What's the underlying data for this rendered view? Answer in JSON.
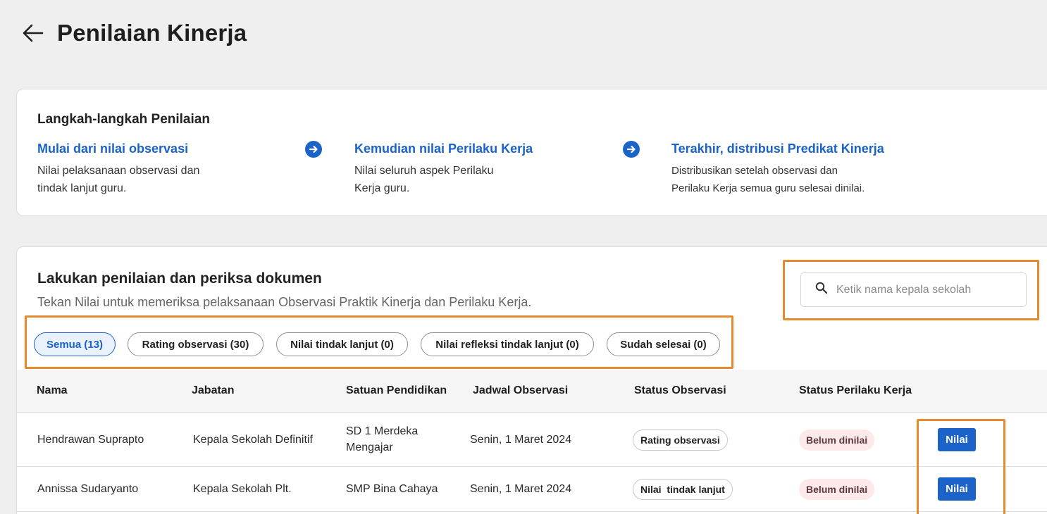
{
  "header": {
    "title": "Penilaian Kinerja",
    "back_icon": "arrow-left-icon"
  },
  "steps": {
    "title": "Langkah-langkah Penilaian",
    "items": [
      {
        "link": "Mulai dari nilai observasi",
        "desc_line1": "Nilai pelaksanaan observasi dan",
        "desc_line2": "tindak lanjut guru."
      },
      {
        "link": "Kemudian nilai Perilaku Kerja",
        "desc_line1": "Nilai seluruh aspek Perilaku",
        "desc_line2": "Kerja guru."
      },
      {
        "link": "Terakhir, distribusi Predikat Kinerja",
        "desc_line1": "Distribusikan setelah observasi dan",
        "desc_line2": "Perilaku Kerja semua guru selesai dinilai."
      }
    ],
    "arrow_icon": "arrow-right-circle-icon"
  },
  "list": {
    "title": "Lakukan penilaian dan periksa dokumen",
    "subtitle": "Tekan Nilai untuk memeriksa pelaksanaan Observasi Praktik Kinerja dan Perilaku Kerja.",
    "search": {
      "placeholder": "Ketik nama kepala sekolah",
      "value": ""
    },
    "filters": [
      {
        "label": "Semua (13)",
        "active": true
      },
      {
        "label": "Rating observasi (30)",
        "active": false
      },
      {
        "label": "Nilai tindak lanjut (0)",
        "active": false
      },
      {
        "label": "Nilai refleksi tindak lanjut (0)",
        "active": false
      },
      {
        "label": "Sudah selesai (0)",
        "active": false
      }
    ],
    "columns": [
      "Nama",
      "Jabatan",
      "Satuan Pendidikan",
      "Jadwal Observasi",
      "Status Observasi",
      "Status Perilaku Kerja"
    ],
    "rows": [
      {
        "nama": "Hendrawan Suprapto",
        "jabatan": "Kepala Sekolah Definitif",
        "satuan_line1": "SD 1 Merdeka",
        "satuan_line2": "Mengajar",
        "jadwal": "Senin, 1 Maret 2024",
        "status_observasi": "Rating observasi",
        "status_perilaku": "Belum dinilai",
        "action": "Nilai"
      },
      {
        "nama": "Annissa Sudaryanto",
        "jabatan": "Kepala Sekolah Plt.",
        "satuan_line1": "SMP Bina Cahaya",
        "satuan_line2": "",
        "jadwal": "Senin, 1 Maret 2024",
        "status_observasi": "Nilai  tindak lanjut",
        "status_perilaku": "Belum dinilai",
        "action": "Nilai"
      }
    ]
  },
  "colors": {
    "accent": "#1b63c8",
    "highlight": "#e58a2e",
    "badge_red_bg": "#fde8ea"
  }
}
